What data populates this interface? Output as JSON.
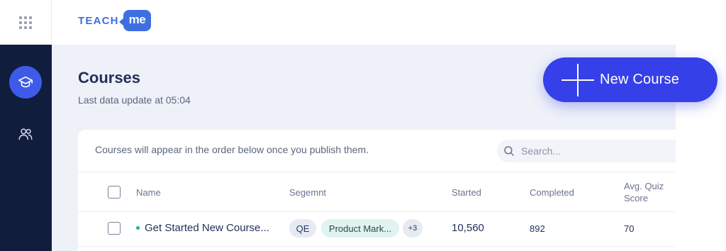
{
  "app": {
    "logo_text": "TEACH",
    "logo_bubble": "me"
  },
  "sidebar": {
    "items": [
      {
        "name": "courses",
        "icon": "graduation-cap-icon",
        "active": true
      },
      {
        "name": "users",
        "icon": "users-icon",
        "active": false
      }
    ]
  },
  "page": {
    "title": "Courses",
    "subtitle": "Last data update at 05:04",
    "new_course_label": "New Course"
  },
  "card": {
    "note": "Courses will appear in the order below once you publish them.",
    "search_placeholder": "Search..."
  },
  "table": {
    "columns": {
      "name": "Name",
      "segment": "Segemnt",
      "started": "Started",
      "completed": "Completed",
      "avg_quiz_line1": "Avg. Quiz",
      "avg_quiz_line2": "Score"
    },
    "rows": [
      {
        "name": "Get Started New Course...",
        "segments": [
          "QE",
          "Product Mark..."
        ],
        "segments_more": "+3",
        "started": "10,560",
        "completed": "892",
        "avg_quiz_score": "70",
        "status_color": "#20b08a"
      }
    ]
  },
  "colors": {
    "accent": "#3640e8",
    "rail_bg": "#101d3d",
    "logo": "#3d6fe0"
  }
}
